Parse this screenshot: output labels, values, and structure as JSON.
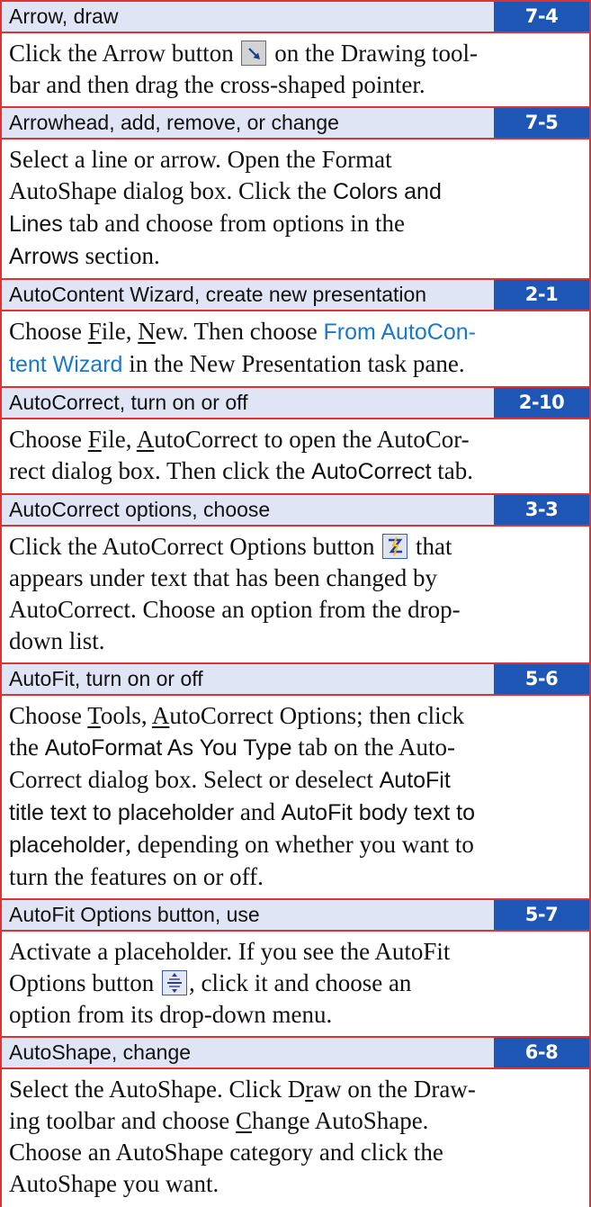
{
  "entries": [
    {
      "title": "Arrow, draw",
      "lesson": "7-4",
      "lines": [
        [
          "Click the Arrow button ",
          "",
          " on the Drawing tool-"
        ],
        [
          "bar and then drag the cross-shaped pointer."
        ]
      ]
    },
    {
      "title": "Arrowhead, add, remove, or change",
      "lesson": "7-5",
      "lines": [
        [
          "Select a line or arrow. Open the Format"
        ],
        [
          "AutoShape dialog box. Click the ",
          "Colors and"
        ],
        [
          "Lines",
          " tab and choose from options in the"
        ],
        [
          "Arrows",
          " section."
        ]
      ]
    },
    {
      "title": "AutoContent Wizard, create new presentation",
      "lesson": "2-1",
      "lines": [
        [
          "Choose ",
          "F",
          "ile, ",
          "N",
          "ew. Then choose ",
          "From AutoCon-"
        ],
        [
          "tent Wizard",
          " in the New Presentation task pane."
        ]
      ]
    },
    {
      "title": "AutoCorrect, turn on or off",
      "lesson": "2-10",
      "lines": [
        [
          "Choose ",
          "F",
          "ile, ",
          "A",
          "utoCorrect to open the AutoCor-"
        ],
        [
          "rect dialog box. Then click the ",
          "AutoCorrect",
          " tab."
        ]
      ]
    },
    {
      "title": "AutoCorrect options, choose",
      "lesson": "3-3",
      "lines": [
        [
          "Click the AutoCorrect Options button ",
          "",
          " that"
        ],
        [
          "appears under text that has been changed by"
        ],
        [
          "AutoCorrect. Choose an option from the drop-"
        ],
        [
          "down list."
        ]
      ]
    },
    {
      "title": "AutoFit, turn on or off",
      "lesson": "5-6",
      "lines": [
        [
          "Choose ",
          "T",
          "ools, ",
          "A",
          "utoCorrect Options; then click"
        ],
        [
          "the ",
          "AutoFormat As You Type",
          " tab on the Auto-"
        ],
        [
          "Correct dialog box. Select or deselect ",
          "AutoFit"
        ],
        [
          "title text to placeholder",
          " and ",
          "AutoFit body text to"
        ],
        [
          "placeholder",
          ", depending on whether you want to"
        ],
        [
          "turn the features on or off."
        ]
      ]
    },
    {
      "title": "AutoFit Options button, use",
      "lesson": "5-7",
      "lines": [
        [
          "Activate a placeholder. If you see the AutoFit"
        ],
        [
          "Options button ",
          "",
          ", click it and choose an"
        ],
        [
          "option from its drop-down menu."
        ]
      ]
    },
    {
      "title": "AutoShape, change",
      "lesson": "6-8",
      "lines": [
        [
          "Select the AutoShape. Click D",
          "r",
          "aw on the Draw-"
        ],
        [
          "ing toolbar and choose ",
          "C",
          "hange AutoShape."
        ],
        [
          "Choose an AutoShape category and click the"
        ],
        [
          "AutoShape you want."
        ]
      ]
    }
  ],
  "icons": {
    "arrow_button": "arrow-tool-icon",
    "autocorrect_options": "autocorrect-options-icon",
    "autofit_options": "autofit-options-icon"
  },
  "colors": {
    "rule_red": "#e03232",
    "header_bg": "#dfe5f4",
    "lesson_bg": "#1d56b4",
    "link_blue": "#1a78c8"
  }
}
